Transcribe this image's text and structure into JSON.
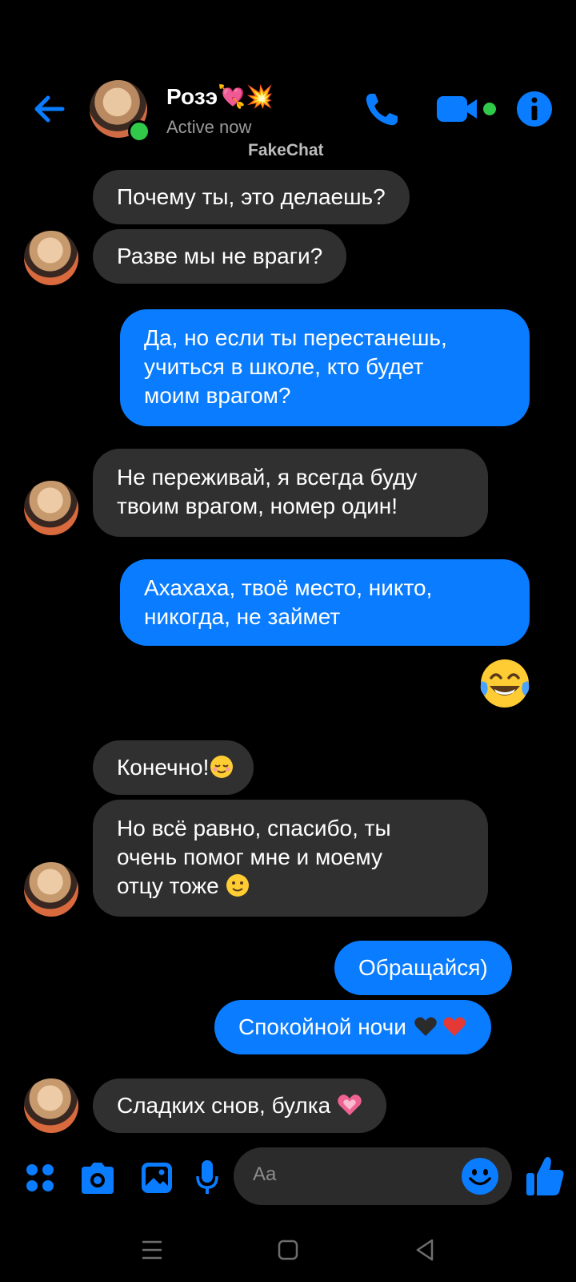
{
  "header": {
    "back_icon": "arrow-left-icon",
    "contact_name": "Розэ💘💥",
    "status": "Active now",
    "watermark": "FakeChat",
    "call_icon": "phone-icon",
    "video_icon": "video-camera-icon",
    "info_icon": "info-icon"
  },
  "messages": [
    {
      "side": "in",
      "text": "Почему ты, это делаешь?"
    },
    {
      "side": "in",
      "text": "Разве мы не враги?"
    },
    {
      "side": "out",
      "lines": [
        "Да, но если ты перестанешь,",
        "учиться в школе, кто будет",
        "моим врагом?"
      ]
    },
    {
      "side": "in",
      "lines": [
        "Не переживай, я всегда буду",
        "твоим врагом, номер один!"
      ]
    },
    {
      "side": "out",
      "lines": [
        "Ахахаха, твоё место, никто,",
        "никогда, не займет"
      ]
    },
    {
      "side": "out",
      "emoji": "face-with-tears-of-joy-icon"
    },
    {
      "side": "in",
      "text": "Конечно!",
      "emoji": "relieved-face-icon"
    },
    {
      "side": "in",
      "lines": [
        "Но всё равно, спасибо, ты",
        "очень помог мне и моему",
        "отцу тоже"
      ],
      "emoji": "slightly-smiling-face-icon"
    },
    {
      "side": "out",
      "text": "Обращайся)"
    },
    {
      "side": "out",
      "text": "Спокойной ночи",
      "emoji": "black-heart-red-heart-icon"
    },
    {
      "side": "in",
      "text": "Сладких снов, булка",
      "emoji": "growing-heart-icon"
    }
  ],
  "composer": {
    "menu_icon": "four-dots-menu-icon",
    "camera_icon": "camera-icon",
    "gallery_icon": "image-icon",
    "mic_icon": "microphone-icon",
    "placeholder": "Aa",
    "emoji_icon": "emoji-icon",
    "like_icon": "thumbs-up-icon"
  },
  "navbar": {
    "recent_icon": "recent-apps-icon",
    "home_icon": "home-icon",
    "back_icon": "back-triangle-icon"
  },
  "colors": {
    "accent": "#0a7cff",
    "incoming_bubble": "#303030",
    "online": "#31c94a",
    "background": "#000000"
  }
}
